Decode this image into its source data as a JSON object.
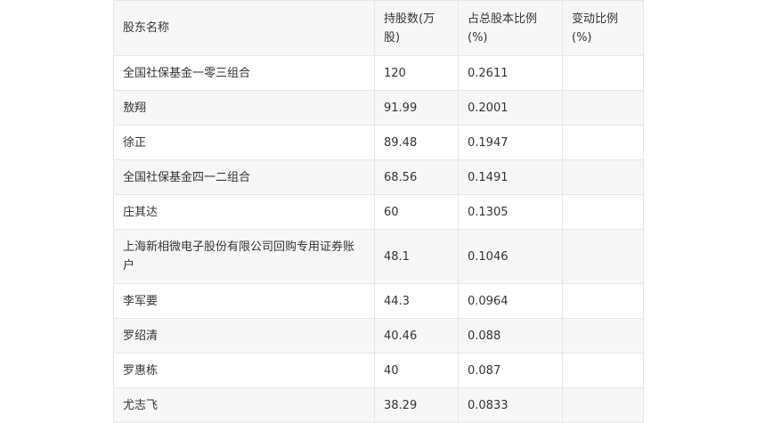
{
  "table": {
    "headers": [
      "股东名称",
      "持股数(万股)",
      "占总股本比例(%)",
      "变动比例(%)"
    ],
    "rows": [
      [
        "全国社保基金一零三组合",
        "120",
        "0.2611",
        ""
      ],
      [
        "敖翔",
        "91.99",
        "0.2001",
        ""
      ],
      [
        "徐正",
        "89.48",
        "0.1947",
        ""
      ],
      [
        "全国社保基金四一二组合",
        "68.56",
        "0.1491",
        ""
      ],
      [
        "庄其达",
        "60",
        "0.1305",
        ""
      ],
      [
        "上海新相微电子股份有限公司回购专用证券账户",
        "48.1",
        "0.1046",
        ""
      ],
      [
        "李军要",
        "44.3",
        "0.0964",
        ""
      ],
      [
        "罗绍清",
        "40.46",
        "0.088",
        ""
      ],
      [
        "罗惠栋",
        "40",
        "0.087",
        ""
      ],
      [
        "尤志飞",
        "38.29",
        "0.0833",
        ""
      ]
    ]
  }
}
